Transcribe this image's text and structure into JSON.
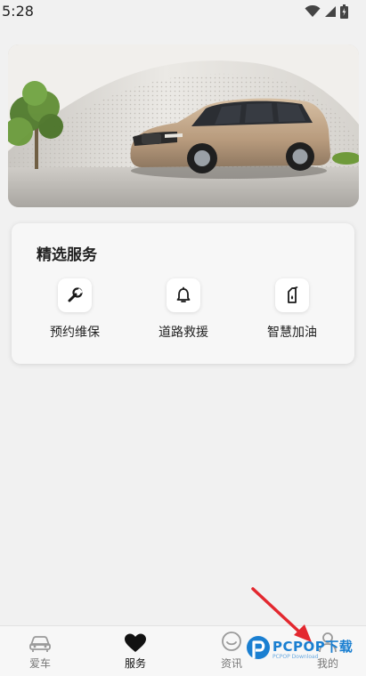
{
  "status_bar": {
    "time": "5:28"
  },
  "featured_services": {
    "title": "精选服务",
    "items": [
      {
        "label": "预约维保",
        "icon": "wrench-icon"
      },
      {
        "label": "道路救援",
        "icon": "bell-icon"
      },
      {
        "label": "智慧加油",
        "icon": "fuel-icon"
      }
    ]
  },
  "tabbar": {
    "tabs": [
      {
        "label": "爱车",
        "icon": "car-icon",
        "active": false
      },
      {
        "label": "服务",
        "icon": "heart-icon",
        "active": true
      },
      {
        "label": "资讯",
        "icon": "chat-icon",
        "active": false
      },
      {
        "label": "我的",
        "icon": "person-icon",
        "active": false
      }
    ]
  },
  "watermark": {
    "text": "PCPOP下载",
    "subtext": "PCPOP Download"
  },
  "colors": {
    "accent": "#111111",
    "inactive": "#777777",
    "watermark": "#1a7fd1",
    "arrow": "#e3282f"
  }
}
